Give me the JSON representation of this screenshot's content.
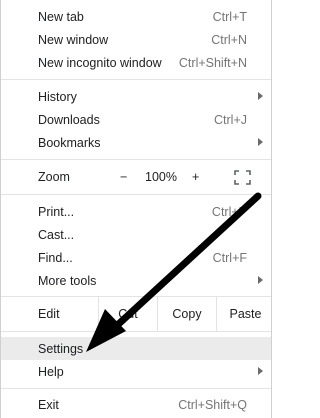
{
  "menu": {
    "group1": [
      {
        "label": "New tab",
        "shortcut": "Ctrl+T"
      },
      {
        "label": "New window",
        "shortcut": "Ctrl+N"
      },
      {
        "label": "New incognito window",
        "shortcut": "Ctrl+Shift+N"
      }
    ],
    "group2": [
      {
        "label": "History",
        "shortcut": "",
        "submenu": true
      },
      {
        "label": "Downloads",
        "shortcut": "Ctrl+J"
      },
      {
        "label": "Bookmarks",
        "shortcut": "",
        "submenu": true
      }
    ],
    "zoom": {
      "label": "Zoom",
      "minus": "−",
      "level": "100%",
      "plus": "+"
    },
    "group3": [
      {
        "label": "Print...",
        "shortcut": "Ctrl+P"
      },
      {
        "label": "Cast...",
        "shortcut": ""
      },
      {
        "label": "Find...",
        "shortcut": "Ctrl+F"
      },
      {
        "label": "More tools",
        "shortcut": "",
        "submenu": true
      }
    ],
    "edit": {
      "label": "Edit",
      "cut": "Cut",
      "copy": "Copy",
      "paste": "Paste"
    },
    "group4": [
      {
        "label": "Settings",
        "shortcut": "",
        "selected": true
      },
      {
        "label": "Help",
        "shortcut": "",
        "submenu": true
      }
    ],
    "exit": {
      "label": "Exit",
      "shortcut": "Ctrl+Shift+Q"
    }
  },
  "icons": {
    "fullscreen": "fullscreen-icon",
    "submenu": "chevron-right-icon"
  },
  "colors": {
    "arrow": "#000000",
    "selected_bg": "#ebebeb",
    "shortcut": "#757575"
  }
}
